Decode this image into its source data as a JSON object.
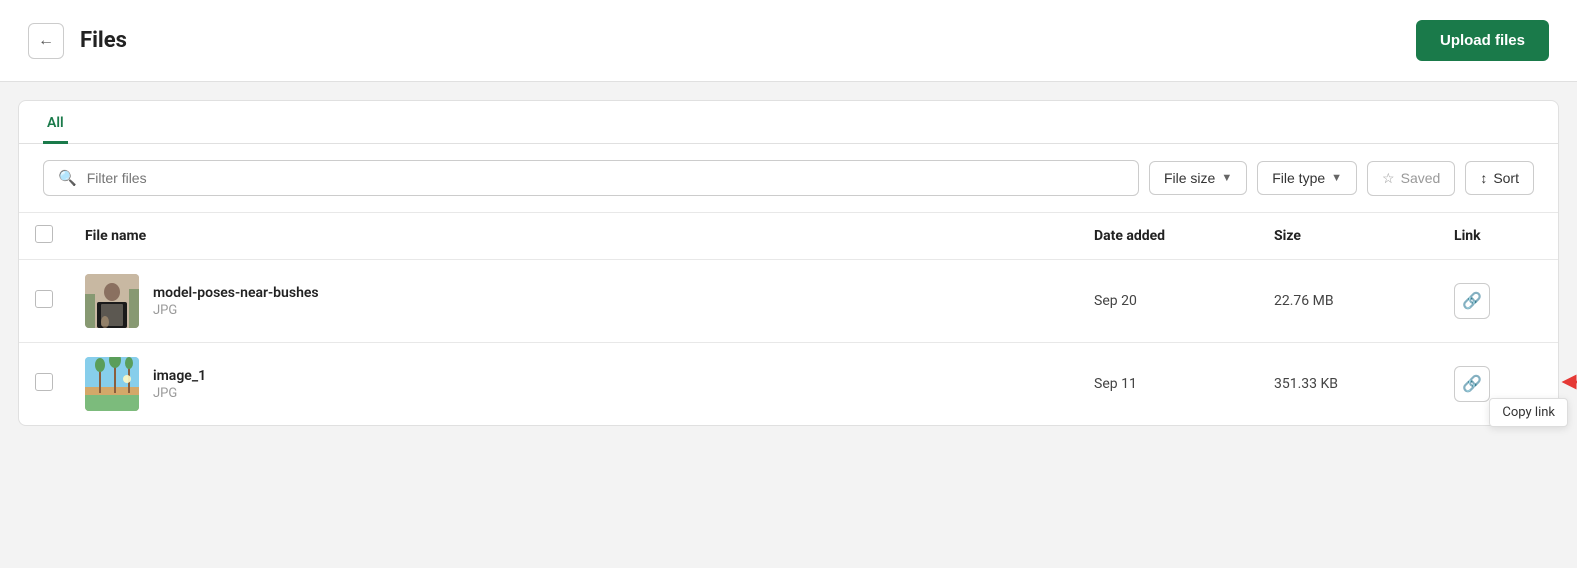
{
  "header": {
    "back_label": "←",
    "title": "Files",
    "upload_btn_label": "Upload files"
  },
  "tabs": [
    {
      "id": "all",
      "label": "All",
      "active": true
    }
  ],
  "toolbar": {
    "search_placeholder": "Filter files",
    "file_size_label": "File size",
    "file_type_label": "File type",
    "saved_label": "Saved",
    "sort_label": "Sort"
  },
  "table": {
    "columns": [
      {
        "key": "checkbox",
        "label": ""
      },
      {
        "key": "name",
        "label": "File name"
      },
      {
        "key": "date",
        "label": "Date added"
      },
      {
        "key": "size",
        "label": "Size"
      },
      {
        "key": "link",
        "label": "Link"
      }
    ],
    "rows": [
      {
        "id": 1,
        "name": "model-poses-near-bushes",
        "ext": "JPG",
        "date": "Sep 20",
        "size": "22.76 MB",
        "thumb_type": "portrait"
      },
      {
        "id": 2,
        "name": "image_1",
        "ext": "JPG",
        "date": "Sep 11",
        "size": "351.33 KB",
        "thumb_type": "landscape",
        "show_tooltip": true,
        "tooltip_label": "Copy link"
      }
    ]
  },
  "icons": {
    "back": "←",
    "search": "🔍",
    "star": "☆",
    "sort": "↕",
    "link": "🔗",
    "dropdown": "▼"
  }
}
